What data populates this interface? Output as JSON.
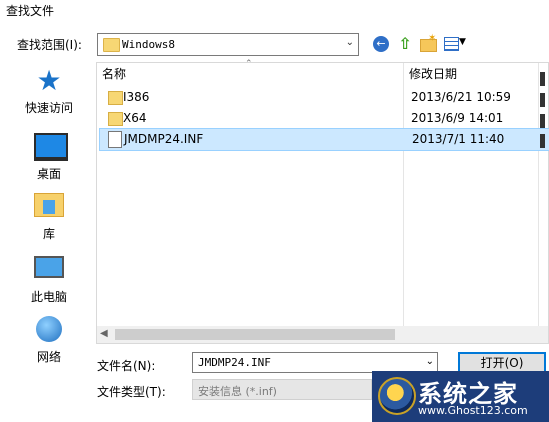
{
  "window": {
    "title": "查找文件"
  },
  "toolbar": {
    "look_in_label": "查找范围(I):",
    "look_in_value": "Windows8",
    "back_icon": "back-arrow-icon",
    "up_icon": "up-folder-icon",
    "new_folder_icon": "new-folder-icon",
    "view_icon": "view-menu-icon"
  },
  "places": [
    {
      "label": "快速访问",
      "icon": "star-icon"
    },
    {
      "label": "桌面",
      "icon": "desktop-icon"
    },
    {
      "label": "库",
      "icon": "library-icon"
    },
    {
      "label": "此电脑",
      "icon": "computer-icon"
    },
    {
      "label": "网络",
      "icon": "network-icon"
    }
  ],
  "columns": {
    "name": "名称",
    "date": "修改日期"
  },
  "files": [
    {
      "name": "I386",
      "date": "2013/6/21 10:59",
      "type": "folder",
      "selected": false
    },
    {
      "name": "X64",
      "date": "2013/6/9 14:01",
      "type": "folder",
      "selected": false
    },
    {
      "name": "JMDMP24.INF",
      "date": "2013/7/1 11:40",
      "type": "file",
      "selected": true
    }
  ],
  "footer": {
    "filename_label": "文件名(N):",
    "filename_value": "JMDMP24.INF",
    "filetype_label": "文件类型(T):",
    "filetype_value": "安装信息 (*.inf)",
    "open_button": "打开(O)"
  },
  "watermark": {
    "title": "系统之家",
    "url": "www.Ghost123.com"
  },
  "colors": {
    "selection": "#cce8ff",
    "accent": "#0078d7"
  }
}
